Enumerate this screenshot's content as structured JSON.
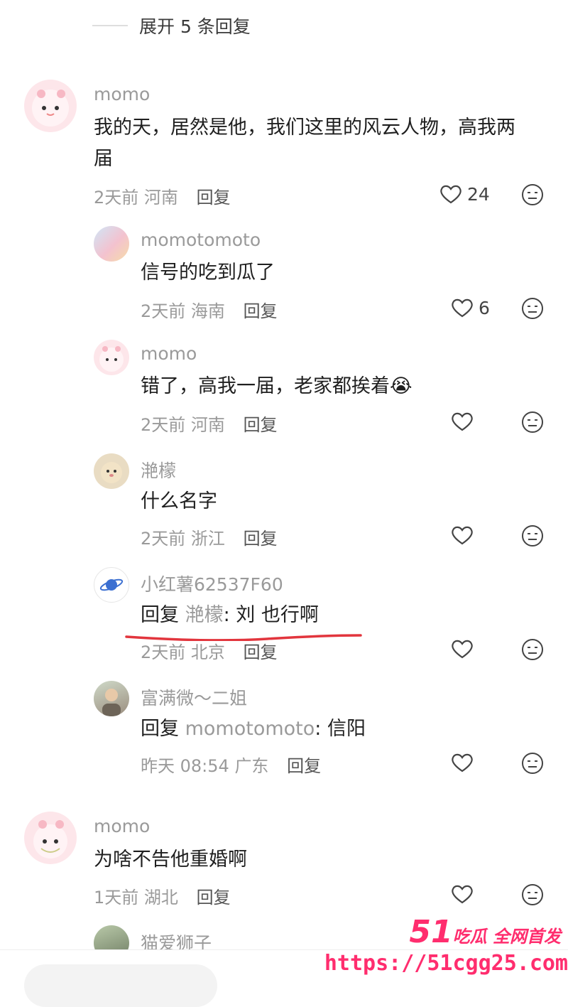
{
  "expand_replies": "展开 5 条回复",
  "comments": [
    {
      "user": "momo",
      "text": "我的天，居然是他，我们这里的风云人物，高我两届",
      "text_line1": "我的天，居然是他，我们这里的风云人物，高我两",
      "text_line2": "届",
      "time": "2天前",
      "location": "河南",
      "reply_label": "回复",
      "likes": "24"
    },
    {
      "user": "momotomoto",
      "text": "信号的吃到瓜了",
      "time": "2天前",
      "location": "海南",
      "reply_label": "回复",
      "likes": "6"
    },
    {
      "user": "momo",
      "text": "错了，高我一届，老家都挨着",
      "emoji": "😭",
      "time": "2天前",
      "location": "河南",
      "reply_label": "回复"
    },
    {
      "user": "滟檬",
      "text": "什么名字",
      "time": "2天前",
      "location": "浙江",
      "reply_label": "回复"
    },
    {
      "user": "小红薯62537F60",
      "reply_prefix": "回复",
      "mention": "滟檬",
      "text": ": 刘  也行啊",
      "time": "2天前",
      "location": "北京",
      "reply_label": "回复"
    },
    {
      "user": "富满微～二姐",
      "reply_prefix": "回复",
      "mention": "momotomoto",
      "text": ": 信阳",
      "time": "昨天 08:54",
      "location": "广东",
      "reply_label": "回复"
    },
    {
      "user": "momo",
      "text": "为啥不告他重婚啊",
      "time": "1天前",
      "location": "湖北",
      "reply_label": "回复"
    },
    {
      "user": "猫爱狮子"
    }
  ],
  "watermark": {
    "num": "51",
    "cn": "吃瓜 全网首发",
    "url": "https://51cgg25.com"
  },
  "colors": {
    "accent_red": "#e2353d",
    "watermark_pink": "#ff2d6e"
  },
  "icons": {
    "like": "heart-outline-icon",
    "emoji": "neutral-face-icon"
  }
}
